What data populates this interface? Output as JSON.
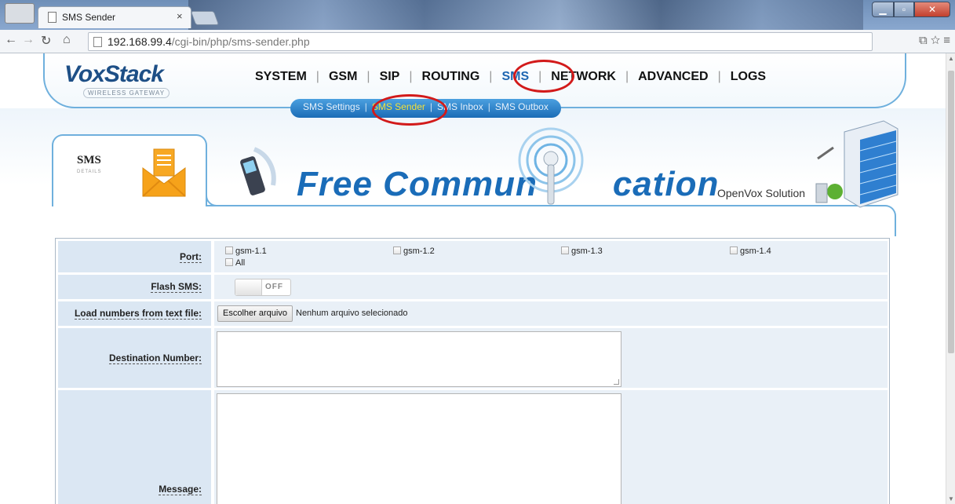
{
  "browser": {
    "tab_title": "SMS Sender",
    "tab_close": "×",
    "url_host": "192.168.99.4",
    "url_path": "/cgi-bin/php/sms-sender.php"
  },
  "header": {
    "logo": "VoxStack",
    "logo_sub": "WIRELESS GATEWAY",
    "nav": [
      "SYSTEM",
      "GSM",
      "SIP",
      "ROUTING",
      "SMS",
      "NETWORK",
      "ADVANCED",
      "LOGS"
    ],
    "active_nav": "SMS",
    "subnav": [
      "SMS Settings",
      "SMS Sender",
      "SMS Inbox",
      "SMS Outbox"
    ],
    "active_subnav": "SMS Sender"
  },
  "banner": {
    "section_title": "SMS",
    "section_sub": "DETAILS",
    "slogan_part1": "Free Commun",
    "slogan_part2": "cation",
    "company": "OpenVox Solution"
  },
  "form": {
    "port_label": "Port:",
    "ports": [
      "gsm-1.1",
      "gsm-1.2",
      "gsm-1.3",
      "gsm-1.4"
    ],
    "port_all": "All",
    "flash_label": "Flash SMS:",
    "flash_state": "OFF",
    "load_label": "Load numbers from text file:",
    "file_button": "Escolher arquivo",
    "file_status": "Nenhum arquivo selecionado",
    "dest_label": "Destination Number:",
    "dest_value": "",
    "message_label": "Message:",
    "message_value": ""
  },
  "colors": {
    "accent": "#1f66b1",
    "highlight_circle": "#d21a1a",
    "label_bg": "#dbe7f3",
    "value_bg": "#e9f0f7"
  }
}
